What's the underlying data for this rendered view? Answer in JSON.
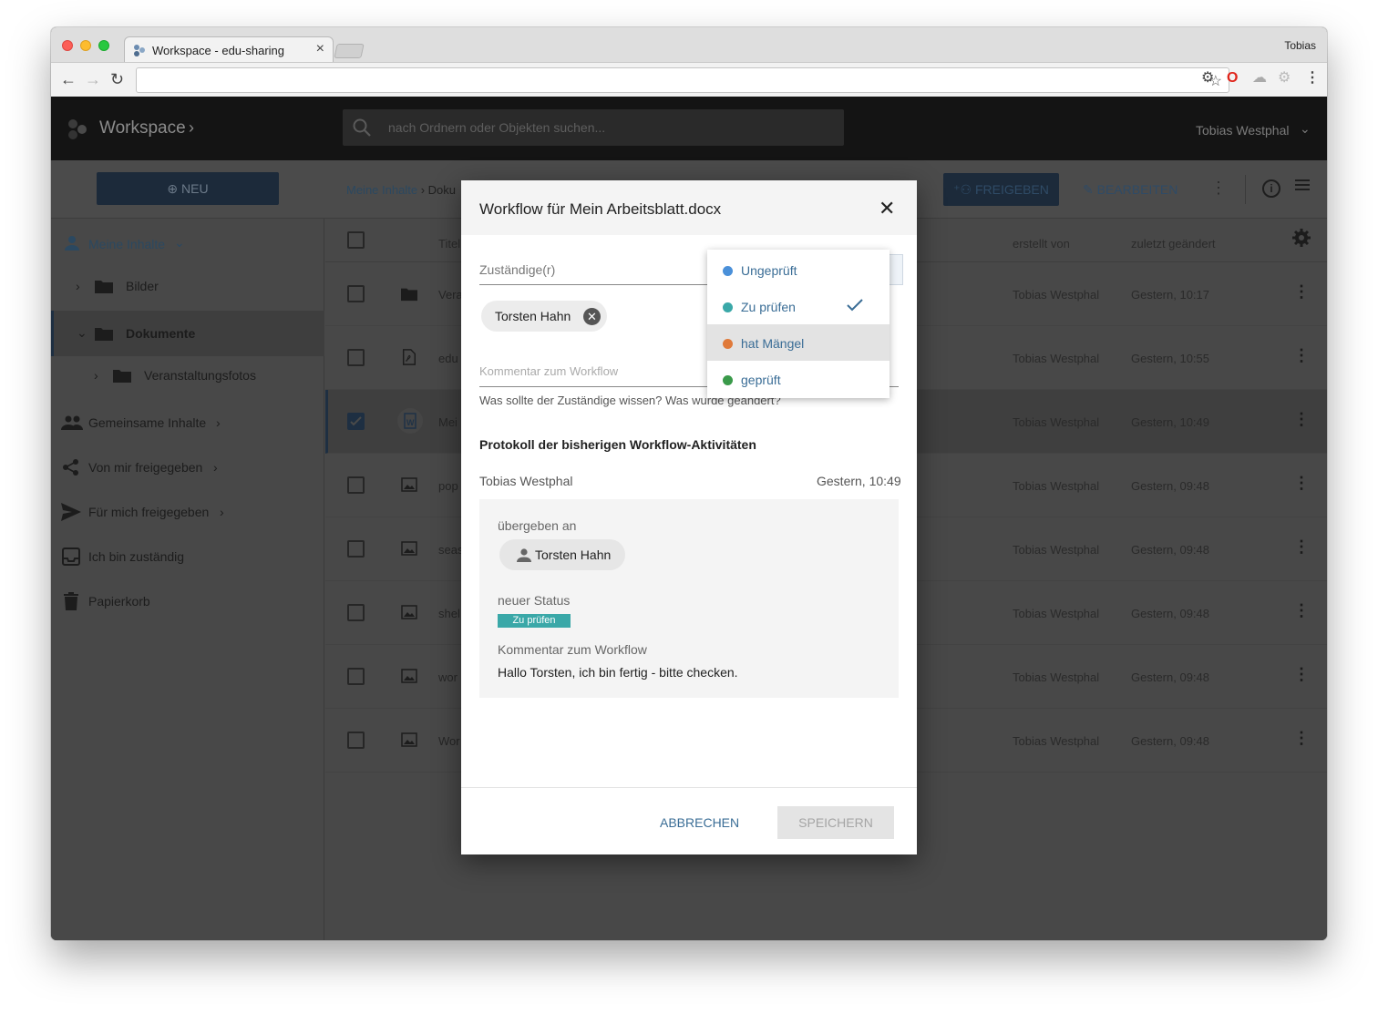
{
  "browser": {
    "tab_title": "Workspace - edu-sharing",
    "tab_close": "×",
    "profile_name": "Tobias",
    "url": ""
  },
  "app": {
    "title": "Workspace",
    "search_placeholder": "nach Ordnern oder Objekten suchen...",
    "user_name": "Tobias Westphal",
    "new_button": "NEU",
    "breadcrumb": [
      "Meine Inhalte",
      "Doku"
    ],
    "share_button": "FREIGEBEN",
    "edit_button": "BEARBEITEN"
  },
  "sidebar": {
    "items": [
      {
        "label": "Meine Inhalte"
      },
      {
        "label": "Bilder"
      },
      {
        "label": "Dokumente"
      },
      {
        "label": "Veranstaltungsfotos"
      },
      {
        "label": "Gemeinsame Inhalte"
      },
      {
        "label": "Von mir freigegeben"
      },
      {
        "label": "Für mich freigegeben"
      },
      {
        "label": "Ich bin zuständig"
      },
      {
        "label": "Papierkorb"
      }
    ]
  },
  "table": {
    "columns": {
      "title": "Titel",
      "created_by": "erstellt von",
      "modified": "zuletzt geändert"
    },
    "rows": [
      {
        "name": "Vera",
        "type": "folder",
        "by": "Tobias Westphal",
        "when": "Gestern, 10:17",
        "selected": false
      },
      {
        "name": "edu",
        "type": "pdf",
        "by": "Tobias Westphal",
        "when": "Gestern, 10:55",
        "selected": false
      },
      {
        "name": "Mei",
        "type": "word",
        "by": "Tobias Westphal",
        "when": "Gestern, 10:49",
        "selected": true
      },
      {
        "name": "pop",
        "type": "image",
        "by": "Tobias Westphal",
        "when": "Gestern, 09:48",
        "selected": false
      },
      {
        "name": "seas",
        "type": "image",
        "by": "Tobias Westphal",
        "when": "Gestern, 09:48",
        "selected": false
      },
      {
        "name": "shel",
        "type": "image",
        "by": "Tobias Westphal",
        "when": "Gestern, 09:48",
        "selected": false
      },
      {
        "name": "wor",
        "type": "image",
        "by": "Tobias Westphal",
        "when": "Gestern, 09:48",
        "selected": false
      },
      {
        "name": "Wor",
        "type": "image",
        "by": "Tobias Westphal",
        "when": "Gestern, 09:48",
        "selected": false
      }
    ]
  },
  "dialog": {
    "title": "Workflow für Mein Arbeitsblatt.docx",
    "assignee_label": "Zuständige(r)",
    "assignee_chip": "Torsten Hahn",
    "comment_placeholder": "Kommentar zum Workflow",
    "comment_hint": "Was sollte der Zuständige wissen? Was wurde geändert?",
    "protocol_heading": "Protokoll der bisherigen Workflow-Aktivitäten",
    "protocol_user": "Tobias Westphal",
    "protocol_time": "Gestern, 10:49",
    "handed_to_label": "übergeben an",
    "handed_to": "Torsten Hahn",
    "new_status_label": "neuer Status",
    "new_status": "Zu prüfen",
    "comment_label": "Kommentar zum Workflow",
    "comment_text": "Hallo Torsten, ich bin fertig - bitte checken.",
    "cancel": "ABBRECHEN",
    "save": "SPEICHERN"
  },
  "status_menu": {
    "options": [
      {
        "label": "Ungeprüft",
        "color": "#4a90d9",
        "checked": false
      },
      {
        "label": "Zu prüfen",
        "color": "#3aa8a8",
        "checked": true
      },
      {
        "label": "hat Mängel",
        "color": "#e07a3a",
        "checked": false
      },
      {
        "label": "geprüft",
        "color": "#3a9a4a",
        "checked": false
      }
    ]
  },
  "colors": {
    "accent": "#3a6d96",
    "topbar": "#141414",
    "status_teal": "#3aa8a8"
  }
}
